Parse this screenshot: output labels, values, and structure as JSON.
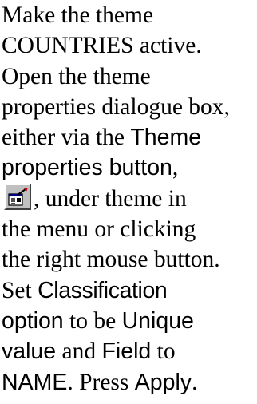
{
  "instructions": {
    "line1": "Make the theme",
    "line2": "COUNTRIES active.",
    "line3": "Open the theme",
    "line4": "properties dialogue box,",
    "line5_prefix": "either via the ",
    "line5_ui": "Theme",
    "line6_ui": "properties button",
    "line6_suffix": ",",
    "line7_after_icon": ", under theme in",
    "line8": "the menu or clicking",
    "line9": "the right mouse button.",
    "line10_prefix": "Set ",
    "line10_ui": "Classification",
    "line11_ui_a": "option",
    "line11_mid": " to be ",
    "line11_ui_b": "Unique",
    "line12_ui_a": "value",
    "line12_mid": " and ",
    "line12_ui_b": "Field",
    "line12_suffix": " to",
    "line13_ui_a": "NAME",
    "line13_mid": ". Press ",
    "line13_ui_b": "Apply",
    "line13_suffix": "."
  },
  "icons": {
    "theme_properties": "theme-properties-icon"
  },
  "colors": {
    "text": "#000000",
    "button_face": "#c0c0c0"
  }
}
